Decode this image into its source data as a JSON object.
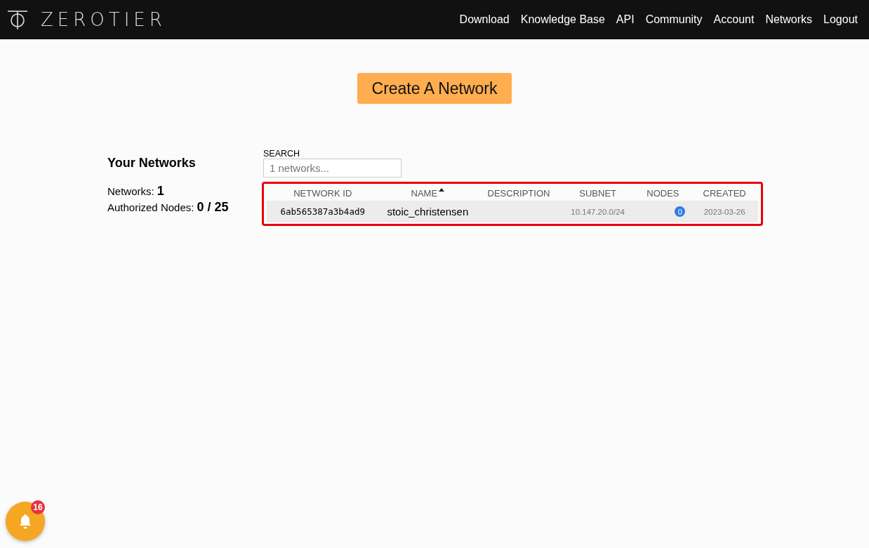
{
  "brand": {
    "name": "ZEROTIER"
  },
  "nav": [
    {
      "label": "Download"
    },
    {
      "label": "Knowledge Base"
    },
    {
      "label": "API"
    },
    {
      "label": "Community"
    },
    {
      "label": "Account"
    },
    {
      "label": "Networks"
    },
    {
      "label": "Logout"
    }
  ],
  "create_button": "Create A Network",
  "summary": {
    "title": "Your Networks",
    "stats": [
      {
        "label": "Networks:",
        "value": "1"
      },
      {
        "label": "Authorized Nodes:",
        "value": "0 / 25"
      }
    ]
  },
  "search": {
    "label": "SEARCH",
    "placeholder": "1 networks..."
  },
  "table": {
    "highlighted": true,
    "columns": [
      {
        "label": "NETWORK ID",
        "sorted": false
      },
      {
        "label": "NAME",
        "sorted": true
      },
      {
        "label": "DESCRIPTION",
        "sorted": false
      },
      {
        "label": "SUBNET",
        "sorted": false
      },
      {
        "label": "NODES",
        "sorted": false
      },
      {
        "label": "CREATED",
        "sorted": false
      }
    ],
    "rows": [
      {
        "network_id": "6ab565387a3b4ad9",
        "name": "stoic_christensen",
        "subnet": "10.147.20.0/24",
        "nodes": "0",
        "created": "2023-03-26"
      }
    ]
  },
  "notifications": {
    "count": "16"
  }
}
